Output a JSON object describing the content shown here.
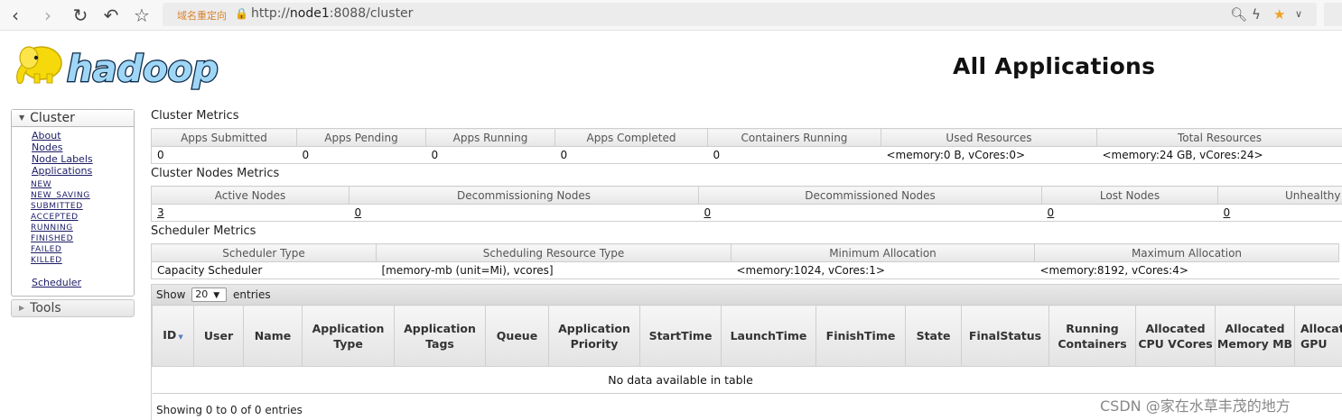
{
  "browser": {
    "back_icon": "chevron-left-icon",
    "forward_icon": "chevron-right-icon",
    "reload_icon": "reload-icon",
    "undo_icon": "undo-icon",
    "bookmark_icon": "star-outline-icon",
    "redirect_tag": "域名重定向",
    "url_prefix": "http://",
    "url_host": "node1",
    "url_rest": ":8088/cluster",
    "zoom_icon": "zoom-icon",
    "bolt_icon": "bolt-icon",
    "star_icon": "star-filled-icon",
    "menu_icon": "chevron-down-icon",
    "accent": "#f2a11b"
  },
  "header": {
    "logo_text": "hadoop",
    "title": "All Applications"
  },
  "sidebar": {
    "cluster_label": "Cluster",
    "links": [
      "About",
      "Nodes",
      "Node Labels",
      "Applications"
    ],
    "app_states": [
      "NEW",
      "NEW_SAVING",
      "SUBMITTED",
      "ACCEPTED",
      "RUNNING",
      "FINISHED",
      "FAILED",
      "KILLED"
    ],
    "scheduler": "Scheduler",
    "tools_label": "Tools"
  },
  "cluster_metrics": {
    "label": "Cluster Metrics",
    "headers": [
      "Apps Submitted",
      "Apps Pending",
      "Apps Running",
      "Apps Completed",
      "Containers Running",
      "Used Resources",
      "Total Resources"
    ],
    "values": [
      "0",
      "0",
      "0",
      "0",
      "0",
      "<memory:0 B, vCores:0>",
      "<memory:24 GB, vCores:24>"
    ]
  },
  "node_metrics": {
    "label": "Cluster Nodes Metrics",
    "headers": [
      "Active Nodes",
      "Decommissioning Nodes",
      "Decommissioned Nodes",
      "Lost Nodes",
      "Unhealthy"
    ],
    "values": [
      "3",
      "0",
      "0",
      "0",
      "0"
    ]
  },
  "scheduler_metrics": {
    "label": "Scheduler Metrics",
    "headers": [
      "Scheduler Type",
      "Scheduling Resource Type",
      "Minimum Allocation",
      "Maximum Allocation"
    ],
    "values": [
      "Capacity Scheduler",
      "[memory-mb (unit=Mi), vcores]",
      "<memory:1024, vCores:1>",
      "<memory:8192, vCores:4>"
    ]
  },
  "apps_table": {
    "show_label": "Show",
    "page_size": "20",
    "entries_label": "entries",
    "headers": [
      "ID",
      "User",
      "Name",
      "Application Type",
      "Application Tags",
      "Queue",
      "Application Priority",
      "StartTime",
      "LaunchTime",
      "FinishTime",
      "State",
      "FinalStatus",
      "Running Containers",
      "Allocated CPU VCores",
      "Allocated Memory MB",
      "Allocated GPU"
    ],
    "empty_message": "No data available in table",
    "footer": "Showing 0 to 0 of 0 entries"
  },
  "watermark": "CSDN @家在水草丰茂的地方"
}
